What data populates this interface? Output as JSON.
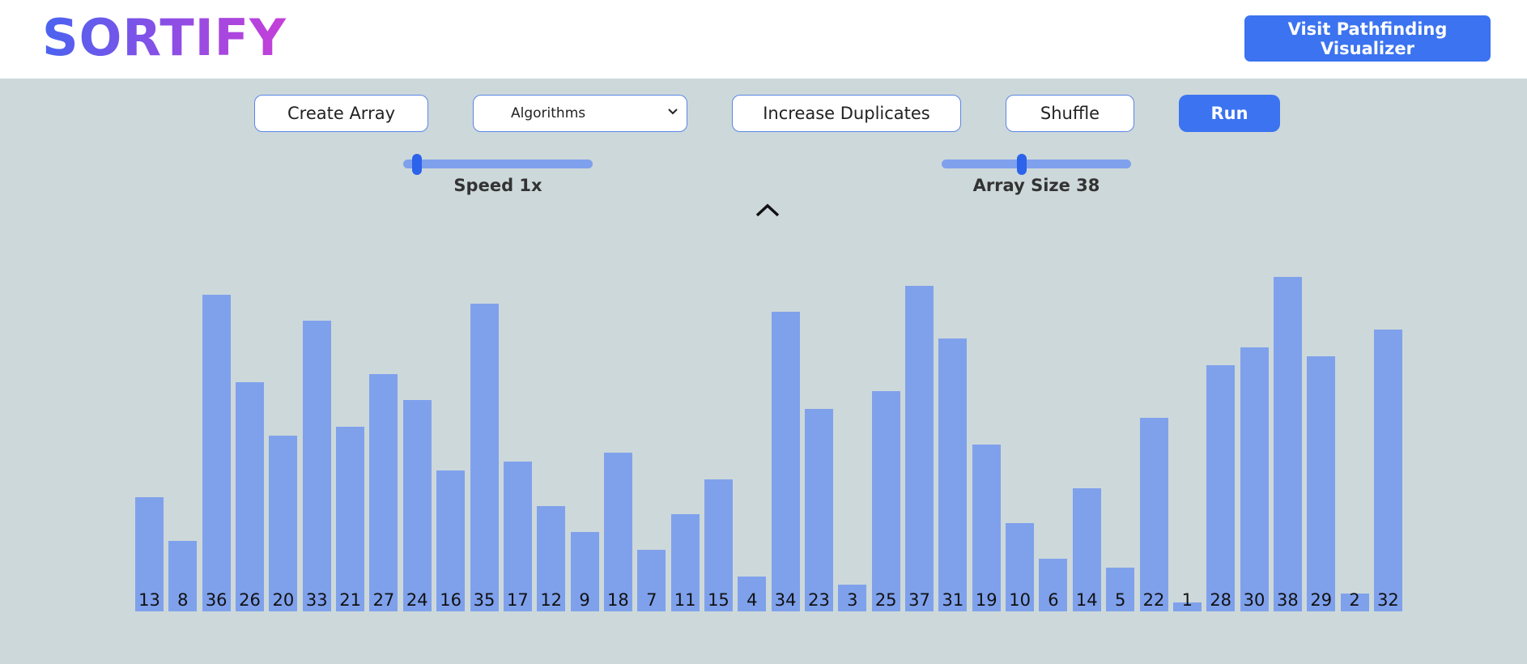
{
  "header": {
    "logo": "SORTIFY",
    "pathfinding_button": "Visit Pathfinding Visualizer"
  },
  "controls": {
    "create_array": "Create Array",
    "algorithms": "Algorithms",
    "increase_duplicates": "Increase Duplicates",
    "shuffle": "Shuffle",
    "run": "Run",
    "speed_label": "Speed 1x",
    "array_size_label": "Array Size 38",
    "speed_level": 0.05,
    "array_size_level": 0.42
  },
  "icons": {
    "collapse": "chevron-up-icon",
    "select": "chevron-down-icon"
  },
  "colors": {
    "background": "#cdd8da",
    "bar": "#7fa1ec",
    "accent": "#3b73f0"
  },
  "chart_data": {
    "type": "bar",
    "values": [
      13,
      8,
      36,
      26,
      20,
      33,
      21,
      27,
      24,
      16,
      35,
      17,
      12,
      9,
      18,
      7,
      11,
      15,
      4,
      34,
      23,
      3,
      25,
      37,
      31,
      19,
      10,
      6,
      14,
      5,
      22,
      1,
      28,
      30,
      38,
      29,
      2,
      32
    ]
  }
}
